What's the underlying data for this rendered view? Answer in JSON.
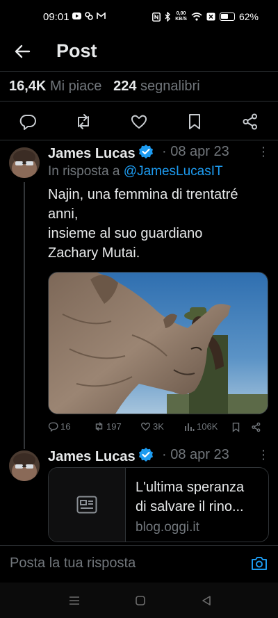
{
  "status_bar": {
    "time": "09:01",
    "net_speed_value": "0,00",
    "net_speed_unit": "KB/S",
    "battery": "62%"
  },
  "header": {
    "title": "Post"
  },
  "stats": {
    "likes_count": "16,4K",
    "likes_label": "Mi piace",
    "bookmarks_count": "224",
    "bookmarks_label": "segnalibri"
  },
  "tweets": [
    {
      "name": "James Lucas",
      "date": "08 apr 23",
      "reply_prefix": "In risposta a",
      "reply_handle": "@JamesLucasIT",
      "text_lines": [
        "Najin, una femmina di trentatré",
        "anni,",
        "insieme al suo guardiano",
        "Zachary Mutai."
      ],
      "metrics": {
        "replies": "16",
        "reposts": "197",
        "likes": "3K",
        "views": "106K"
      }
    },
    {
      "name": "James Lucas",
      "date": "08 apr 23",
      "card": {
        "title_lines": [
          "L'ultima speranza",
          "di salvare il rino..."
        ],
        "domain": "blog.oggi.it"
      }
    }
  ],
  "reply_bar": {
    "placeholder": "Posta la tua risposta"
  },
  "colors": {
    "accent": "#1d9bf0",
    "muted": "#71767b",
    "text": "#e7e9ea",
    "divider": "#2f3336"
  },
  "icons": [
    "back-arrow-icon",
    "reply-icon",
    "repost-icon",
    "like-icon",
    "bookmark-icon",
    "share-icon",
    "verified-badge-icon",
    "views-icon",
    "article-icon",
    "camera-icon"
  ]
}
